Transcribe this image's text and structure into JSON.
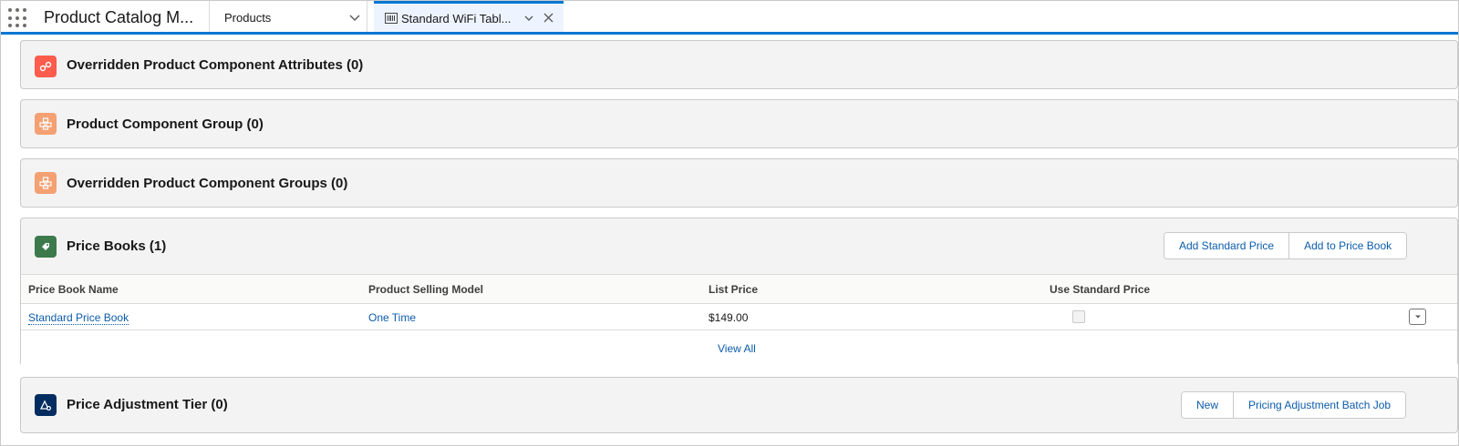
{
  "app": {
    "name": "Product Catalog M...",
    "nav_item": "Products"
  },
  "active_tab": {
    "label": "Standard WiFi Tabl..."
  },
  "cards": {
    "overridden_attributes": {
      "title": "Overridden Product Component Attributes (0)",
      "icon": "attribute-icon",
      "color": "#fe5c4c"
    },
    "component_group": {
      "title": "Product Component Group (0)",
      "icon": "component-group-icon",
      "color": "#f4a072"
    },
    "overridden_groups": {
      "title": "Overridden Product Component Groups (0)",
      "icon": "component-group-icon",
      "color": "#f4a072"
    },
    "price_books": {
      "title": "Price Books (1)",
      "icon": "pricebook-icon",
      "color": "#3c7a4c",
      "buttons": {
        "add_standard_price": "Add Standard Price",
        "add_to_price_book": "Add to Price Book"
      },
      "columns": [
        "Price Book Name",
        "Product Selling Model",
        "List Price",
        "Use Standard Price"
      ],
      "rows": [
        {
          "name": "Standard Price Book",
          "selling_model": "One Time",
          "list_price": "$149.00",
          "use_standard_price": false
        }
      ],
      "view_all": "View All"
    },
    "price_adjustment": {
      "title": "Price Adjustment Tier (0)",
      "icon": "price-adjustment-icon",
      "color": "#032d60",
      "buttons": {
        "new": "New",
        "batch_job": "Pricing Adjustment Batch Job"
      }
    }
  },
  "colors": {
    "accent": "#0176d3",
    "link": "#0b5cab"
  }
}
